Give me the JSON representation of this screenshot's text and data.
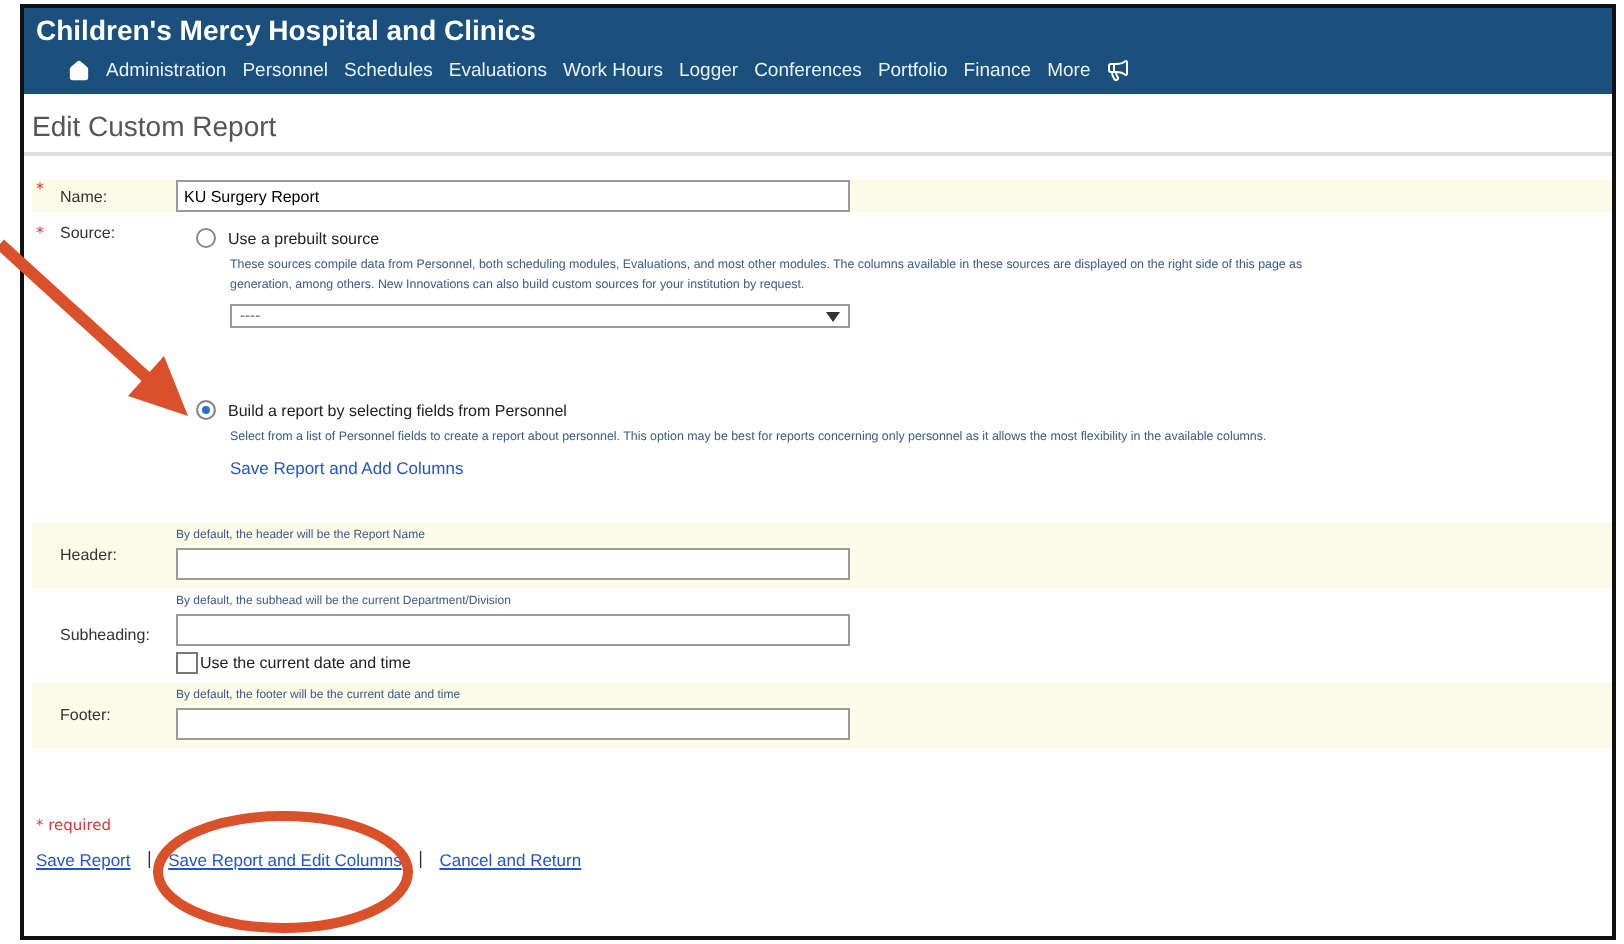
{
  "header": {
    "title": "Children's Mercy Hospital and Clinics",
    "nav": [
      "Administration",
      "Personnel",
      "Schedules",
      "Evaluations",
      "Work Hours",
      "Logger",
      "Conferences",
      "Portfolio",
      "Finance",
      "More"
    ]
  },
  "page_title": "Edit Custom Report",
  "name_field": {
    "mark": "*",
    "label": "Name:",
    "value": "KU Surgery Report"
  },
  "source": {
    "mark": "*",
    "label": "Source:",
    "options": [
      {
        "label": "Use a prebuilt source",
        "selected": false,
        "description": [
          "These sources compile data from Personnel, both scheduling modules, Evaluations, and most other modules. The columns available in these sources are displayed on the right side of this page as",
          "generation, among others. New Innovations can also build custom sources for your institution by request."
        ],
        "select_value": "----"
      },
      {
        "label": "Build a report by selecting fields from Personnel",
        "selected": true,
        "description": [
          "Select from a list of Personnel fields to create a report about personnel. This option may be best for reports concerning only personnel as it allows the most flexibility in the available columns."
        ],
        "link": "Save Report and Add Columns"
      }
    ]
  },
  "fields": [
    {
      "label": "Header:",
      "hint": "By default, the header will be the Report Name",
      "highlighted": true
    },
    {
      "label": "Subheading:",
      "hint": "By default, the subhead will be the current Department/Division",
      "highlighted": false,
      "checkbox": {
        "label": "Use the current date and time",
        "checked": false
      }
    },
    {
      "label": "Footer:",
      "hint": "By default, the footer will be the current date and time",
      "highlighted": true
    }
  ],
  "required_note": "* required",
  "links": [
    "Save Report",
    "Save Report and Edit Columns",
    "Cancel and Return"
  ],
  "link_separator": "|"
}
